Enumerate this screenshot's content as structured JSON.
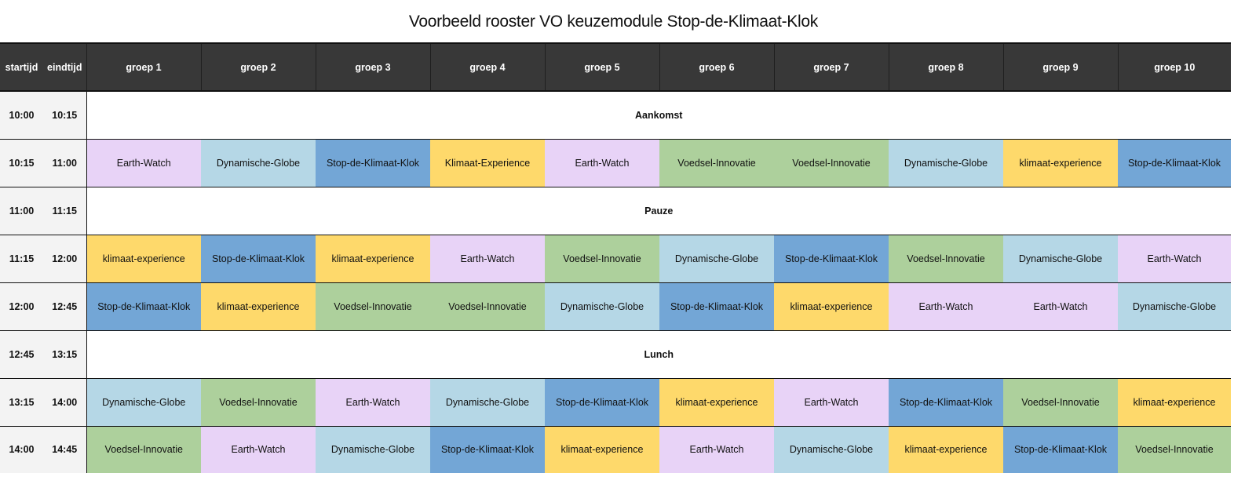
{
  "title": "Voorbeeld rooster VO keuzemodule  Stop-de-Klimaat-Klok",
  "colors": {
    "header_bg": "#383838",
    "header_text": "#ffffff",
    "time_bg": "#f3f3f3",
    "Earth-Watch": "#e8d3f7",
    "Dynamische-Globe": "#b5d7e6",
    "Stop-de-Klimaat-Klok": "#73a6d6",
    "Klimaat-Experience": "#fed96b",
    "klimaat-experience": "#fed96b",
    "Voedsel-Innovatie": "#add09c"
  },
  "columns": {
    "start": "startijd",
    "end": "eindtijd",
    "groups": [
      "groep 1",
      "groep 2",
      "groep 3",
      "groep 4",
      "groep 5",
      "groep 6",
      "groep 7",
      "groep 8",
      "groep 9",
      "groep 10"
    ]
  },
  "rows": [
    {
      "start": "10:00",
      "end": "10:15",
      "span": "Aankomst"
    },
    {
      "start": "10:15",
      "end": "11:00",
      "cells": [
        "Earth-Watch",
        "Dynamische-Globe",
        "Stop-de-Klimaat-Klok",
        "Klimaat-Experience",
        "Earth-Watch",
        "Voedsel-Innovatie",
        "Voedsel-Innovatie",
        "Dynamische-Globe",
        "klimaat-experience",
        "Stop-de-Klimaat-Klok"
      ]
    },
    {
      "start": "11:00",
      "end": "11:15",
      "span": "Pauze"
    },
    {
      "start": "11:15",
      "end": "12:00",
      "cells": [
        "klimaat-experience",
        "Stop-de-Klimaat-Klok",
        "klimaat-experience",
        "Earth-Watch",
        "Voedsel-Innovatie",
        "Dynamische-Globe",
        "Stop-de-Klimaat-Klok",
        "Voedsel-Innovatie",
        "Dynamische-Globe",
        "Earth-Watch"
      ]
    },
    {
      "start": "12:00",
      "end": "12:45",
      "cells": [
        "Stop-de-Klimaat-Klok",
        "klimaat-experience",
        "Voedsel-Innovatie",
        "Voedsel-Innovatie",
        "Dynamische-Globe",
        "Stop-de-Klimaat-Klok",
        "klimaat-experience",
        "Earth-Watch",
        "Earth-Watch",
        "Dynamische-Globe"
      ]
    },
    {
      "start": "12:45",
      "end": "13:15",
      "span": "Lunch"
    },
    {
      "start": "13:15",
      "end": "14:00",
      "cells": [
        "Dynamische-Globe",
        "Voedsel-Innovatie",
        "Earth-Watch",
        "Dynamische-Globe",
        "Stop-de-Klimaat-Klok",
        "klimaat-experience",
        "Earth-Watch",
        "Stop-de-Klimaat-Klok",
        "Voedsel-Innovatie",
        "klimaat-experience"
      ]
    },
    {
      "start": "14:00",
      "end": "14:45",
      "cells": [
        "Voedsel-Innovatie",
        "Earth-Watch",
        "Dynamische-Globe",
        "Stop-de-Klimaat-Klok",
        "klimaat-experience",
        "Earth-Watch",
        "Dynamische-Globe",
        "klimaat-experience",
        "Stop-de-Klimaat-Klok",
        "Voedsel-Innovatie"
      ]
    }
  ]
}
